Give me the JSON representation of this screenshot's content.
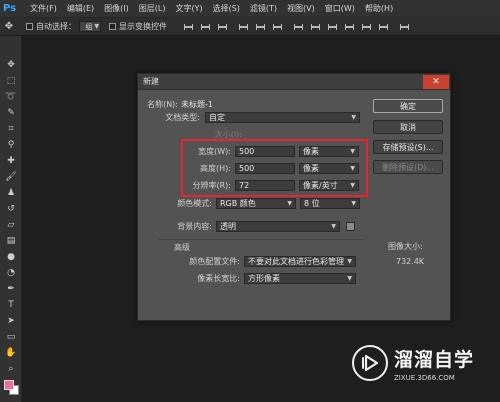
{
  "app": {
    "logo": "Ps"
  },
  "menubar": {
    "items": [
      "文件(F)",
      "编辑(E)",
      "图像(I)",
      "图层(L)",
      "文字(Y)",
      "选择(S)",
      "滤镜(T)",
      "视图(V)",
      "窗口(W)",
      "帮助(H)"
    ]
  },
  "options": {
    "auto_select_label": "自动选择：",
    "group_value": "组",
    "show_transform_label": "显示变换控件"
  },
  "dialog": {
    "title": "新建",
    "close_glyph": "✕",
    "name_label": "名称(N):",
    "name_value": "未标题-1",
    "doc_type_label": "文档类型:",
    "doc_type_value": "自定",
    "size_label": "大小(I):",
    "width_label": "宽度(W):",
    "width_value": "500",
    "width_unit": "像素",
    "height_label": "高度(H):",
    "height_value": "500",
    "height_unit": "像素",
    "resolution_label": "分辨率(R):",
    "resolution_value": "72",
    "resolution_unit": "像素/英寸",
    "color_mode_label": "颜色模式:",
    "color_mode_value": "RGB 颜色",
    "bit_depth_value": "8 位",
    "bg_contents_label": "背景内容:",
    "bg_contents_value": "透明",
    "advanced_label": "高级",
    "color_profile_label": "颜色配置文件:",
    "color_profile_value": "不要对此文档进行色彩管理",
    "pixel_aspect_label": "像素长宽比:",
    "pixel_aspect_value": "方形像素",
    "ok_label": "确定",
    "cancel_label": "取消",
    "save_preset_label": "存储预设(S)...",
    "delete_preset_label": "删除预设(D)...",
    "image_size_label": "图像大小:",
    "image_size_value": "732.4K"
  },
  "watermark": {
    "title": "溜溜自学",
    "subtitle": "ZIXUE.3D66.COM"
  },
  "colors": {
    "foreground": "#e86fa0",
    "background": "#ffffff",
    "highlight_box": "#e5262d",
    "close_button": "#c8402f"
  }
}
